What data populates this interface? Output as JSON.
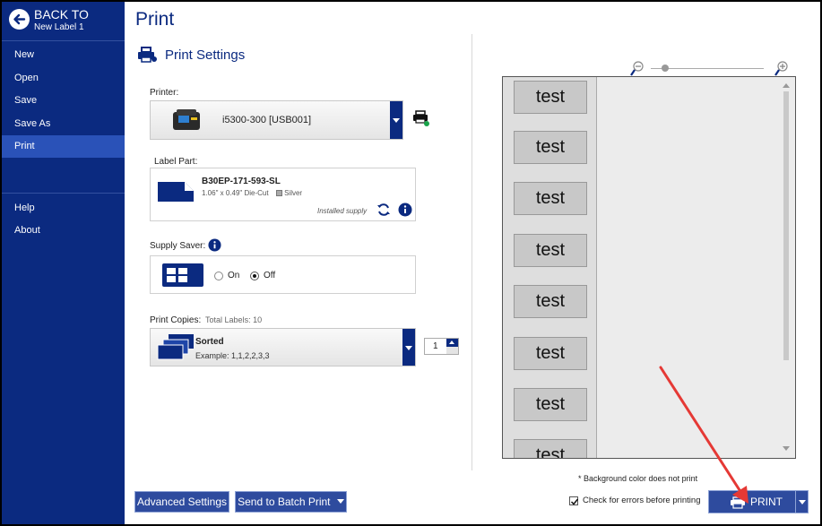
{
  "sidebar": {
    "back_title": "BACK TO",
    "back_sub": "New Label 1",
    "items": [
      {
        "label": "New"
      },
      {
        "label": "Open"
      },
      {
        "label": "Save"
      },
      {
        "label": "Save As"
      },
      {
        "label": "Print",
        "active": true
      },
      {
        "label": "Help"
      },
      {
        "label": "About"
      }
    ]
  },
  "main": {
    "title": "Print",
    "settings_heading": "Print Settings",
    "printer_label": "Printer:",
    "printer_value": "i5300-300 [USB001]",
    "label_part_label": "Label Part:",
    "part_name": "B30EP-171-593-SL",
    "part_desc": "1.06\" x 0.49\"  Die-Cut",
    "part_color": "Silver",
    "installed_supply": "Installed supply",
    "supply_saver_label": "Supply Saver:",
    "on_label": "On",
    "off_label": "Off",
    "supply_saver_selected": "Off",
    "copies_label": "Print Copies:",
    "total_labels": "Total Labels: 10",
    "sort_title": "Sorted",
    "sort_example": "Example: 1,1,2,2,3,3",
    "copies_value": "1",
    "advanced_button": "Advanced Settings",
    "batch_button": "Send to Batch Print"
  },
  "preview": {
    "labels": [
      "test",
      "test",
      "test",
      "test",
      "test",
      "test",
      "test",
      "test"
    ],
    "zoom_level": 0.1,
    "bg_note": "* Background color does not print",
    "check_errors_label": "Check for errors before printing",
    "check_errors_checked": true,
    "print_button": "PRINT"
  },
  "colors": {
    "sidebar": "#0b2a80",
    "accent": "#2e4b9e",
    "active_item": "#2a52b8"
  }
}
